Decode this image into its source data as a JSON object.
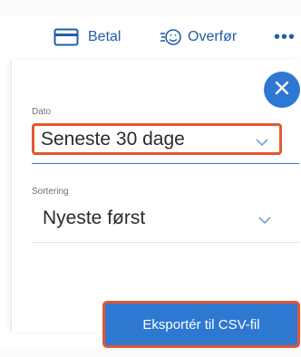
{
  "toolbar": {
    "betal_label": "Betal",
    "betal_icon": "card-icon",
    "overfor_label": "Overfør",
    "overfor_icon": "transfer-chat-icon",
    "more_label": "•••"
  },
  "panel": {
    "close_icon": "close-icon",
    "dato": {
      "label": "Dato",
      "value": "Seneste 30 dage"
    },
    "sortering": {
      "label": "Sortering",
      "value": "Nyeste først"
    },
    "export_label": "Eksportér til CSV-fil"
  },
  "colors": {
    "accent": "#2e78d2",
    "link_blue": "#1f5fa8",
    "highlight_orange": "#e4572e"
  }
}
